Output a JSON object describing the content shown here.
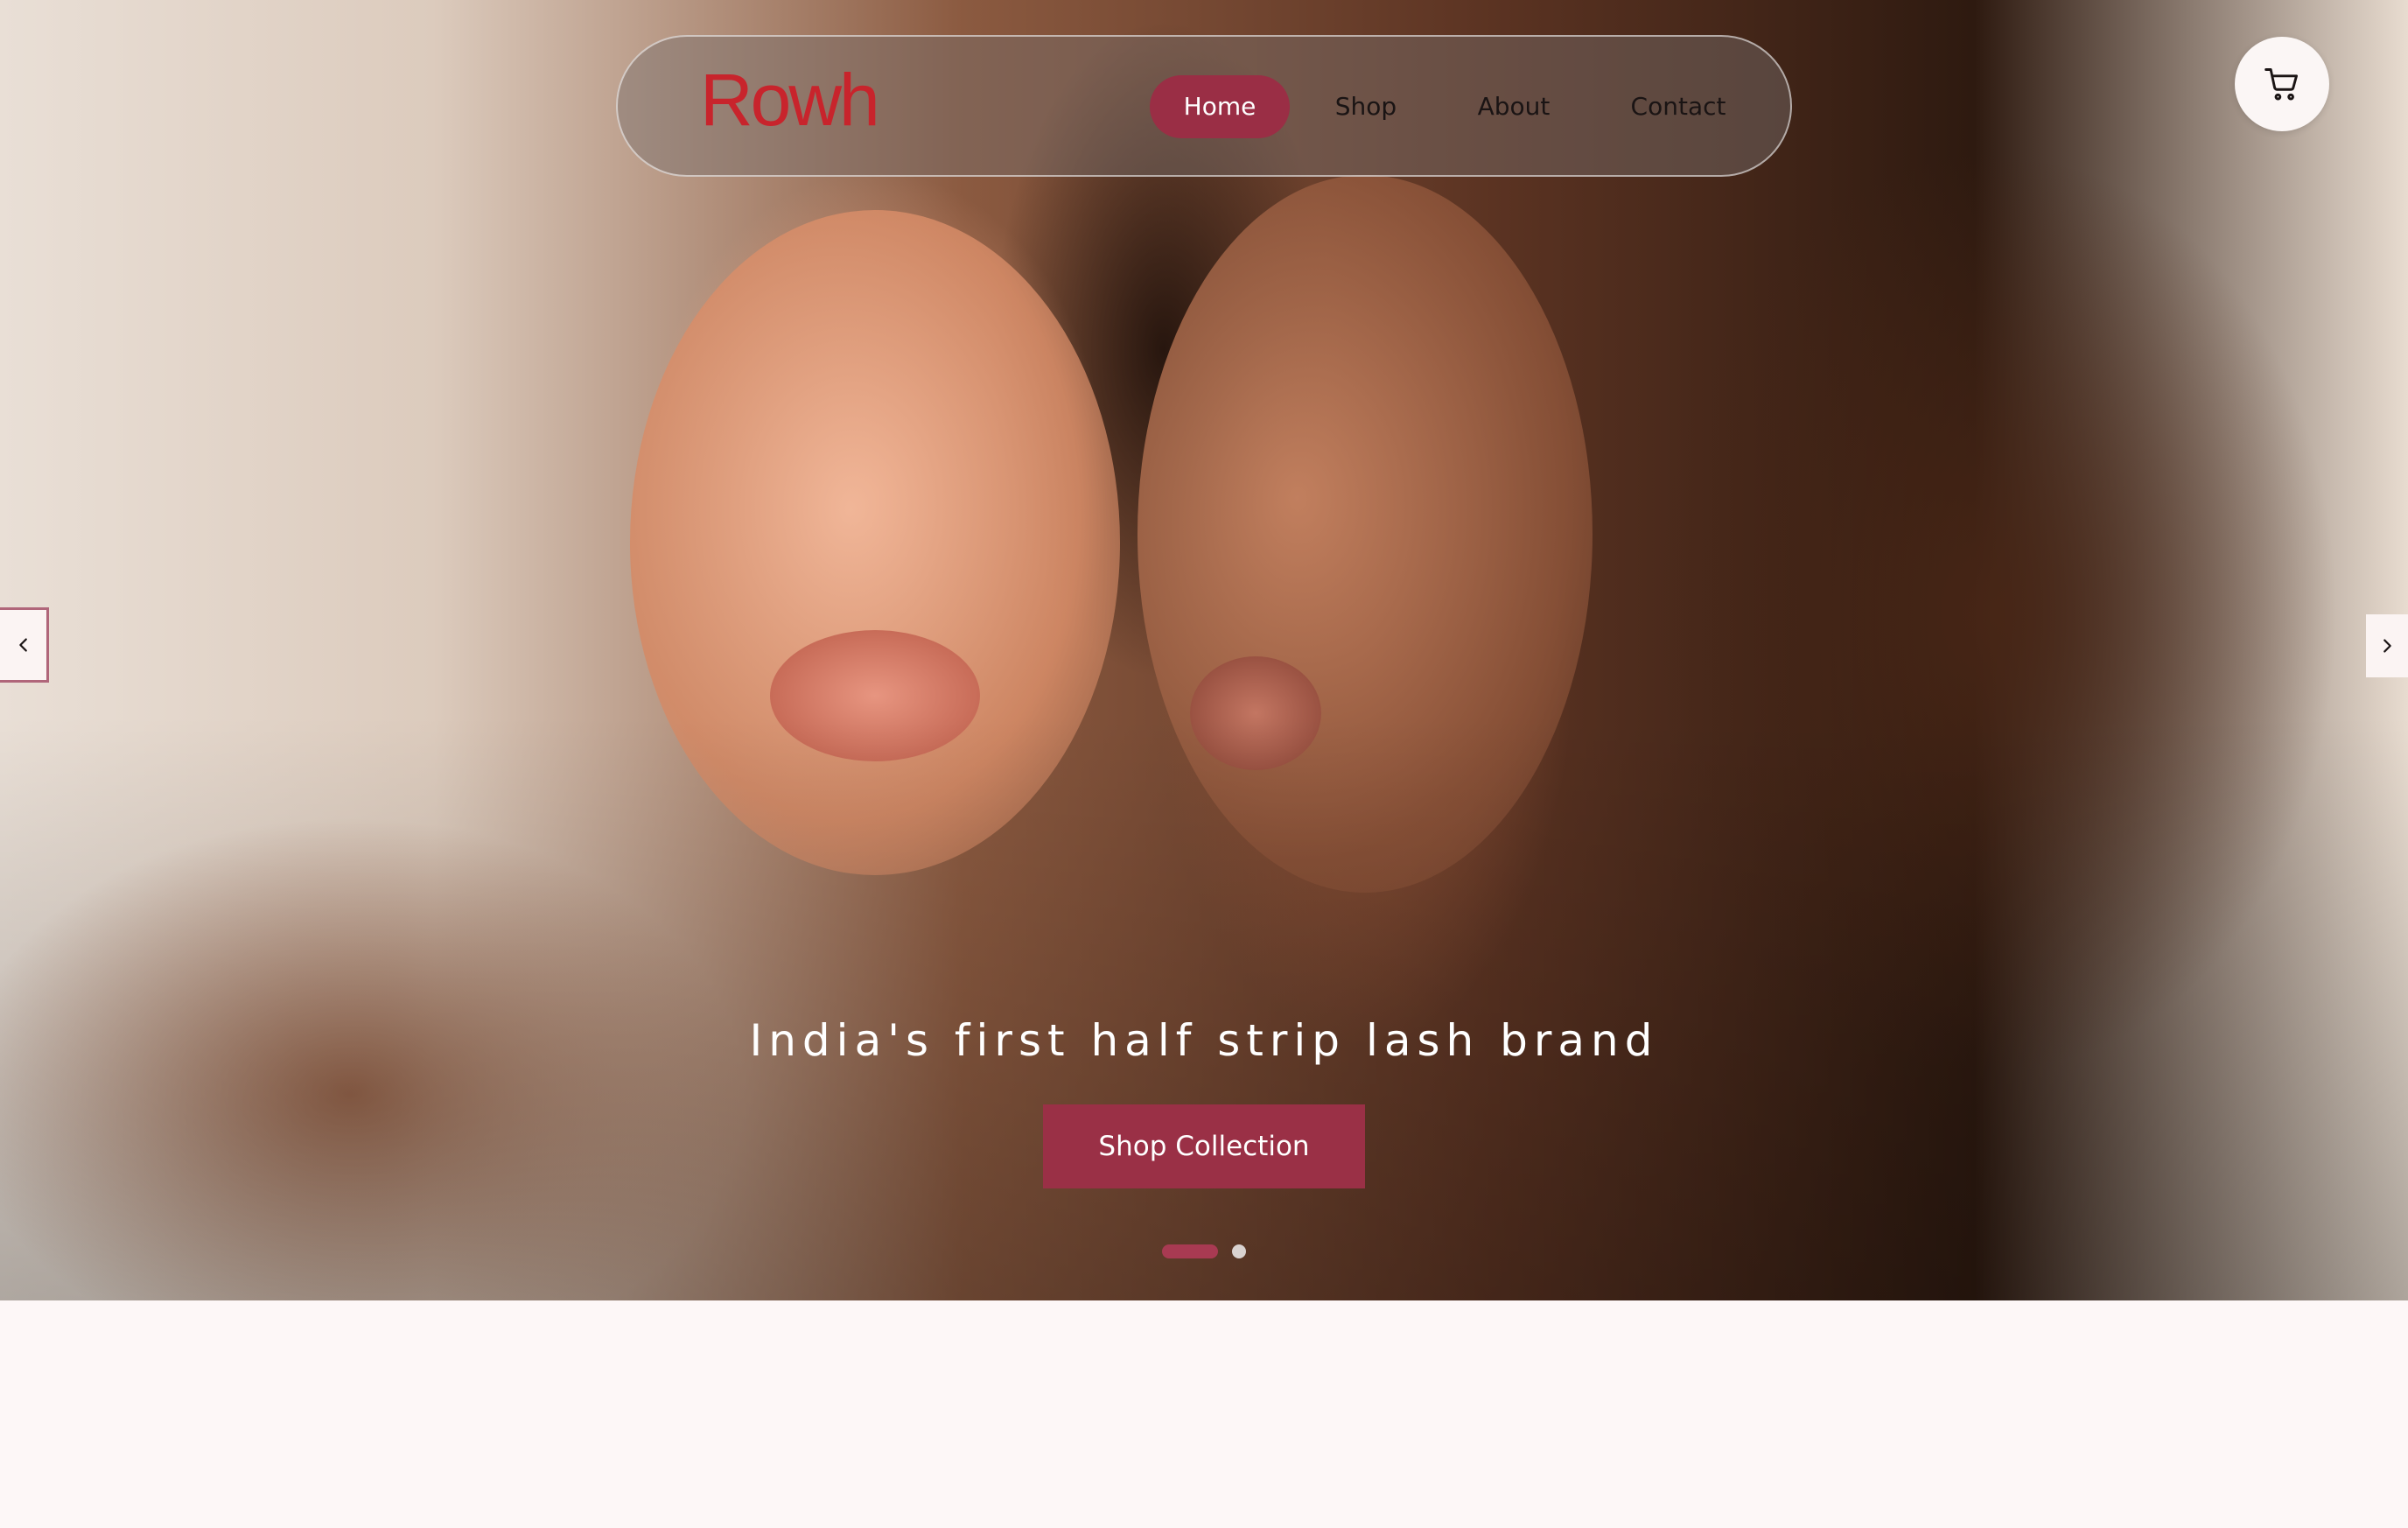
{
  "brand": {
    "logo_text": "Rowh",
    "logo_color": "#c8242c"
  },
  "nav": {
    "items": [
      {
        "label": "Home",
        "active": true
      },
      {
        "label": "Shop",
        "active": false
      },
      {
        "label": "About",
        "active": false
      },
      {
        "label": "Contact",
        "active": false
      }
    ]
  },
  "header": {
    "cart_icon": "cart-icon"
  },
  "hero": {
    "tagline": "India's first half strip lash brand",
    "cta_label": "Shop Collection",
    "prev_icon": "chevron-left-icon",
    "next_icon": "chevron-right-icon",
    "slide_count": 2,
    "active_slide": 1
  },
  "colors": {
    "accent": "#9a2e45",
    "page_background": "#fdf7f7"
  }
}
